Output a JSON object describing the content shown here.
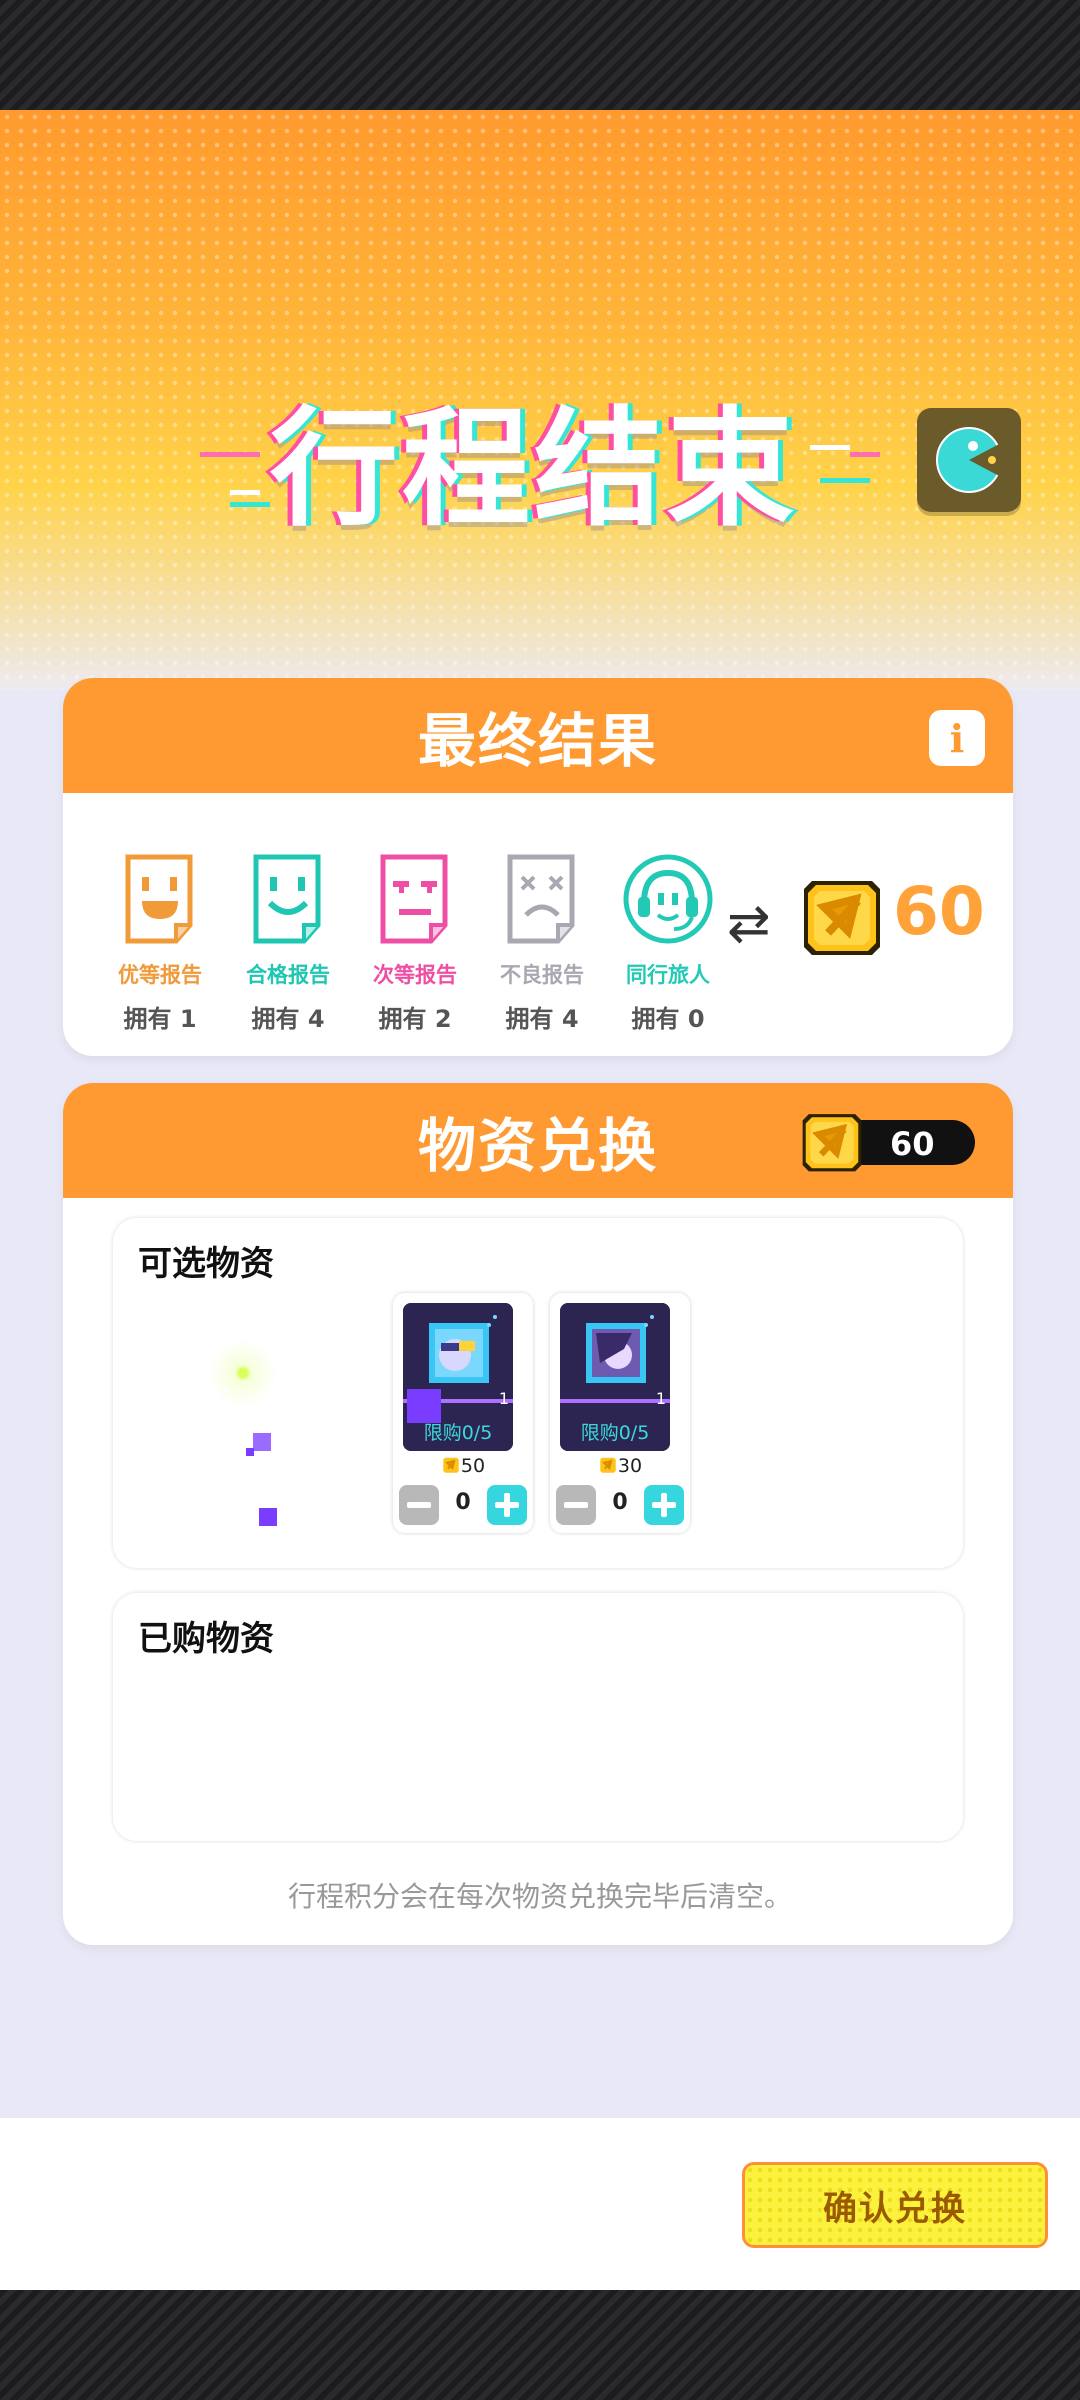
{
  "header": {
    "title": "行程结束",
    "pac_icon": "pacman-icon"
  },
  "result": {
    "title": "最终结果",
    "info_label": "i",
    "reports": [
      {
        "label": "优等报告",
        "owned": "拥有 1",
        "color": "#f09a3a",
        "icon": "happy-report-icon"
      },
      {
        "label": "合格报告",
        "owned": "拥有 4",
        "color": "#1fc7b2",
        "icon": "smile-report-icon"
      },
      {
        "label": "次等报告",
        "owned": "拥有 2",
        "color": "#ee4fa5",
        "icon": "unamused-report-icon"
      },
      {
        "label": "不良报告",
        "owned": "拥有 4",
        "color": "#a8a8b2",
        "icon": "dead-report-icon"
      },
      {
        "label": "同行旅人",
        "owned": "拥有 0",
        "color": "#22c9b5",
        "icon": "headset-traveler-icon"
      }
    ],
    "swap_symbol": "⇄",
    "points": "60"
  },
  "exchange": {
    "title": "物资兑换",
    "balance": "60",
    "available_title": "可选物资",
    "items": [
      {
        "limit": "限购0/5",
        "price": "50",
        "qty": "0",
        "count": "1"
      },
      {
        "limit": "限购0/5",
        "price": "30",
        "qty": "0",
        "count": "1"
      }
    ],
    "purchased_title": "已购物资"
  },
  "note": "行程积分会在每次物资兑换完毕后清空。",
  "confirm_label": "确认兑换",
  "colors": {
    "accent": "#ff9a33",
    "teal": "#35d6de",
    "confirm": "#fcf23d"
  }
}
